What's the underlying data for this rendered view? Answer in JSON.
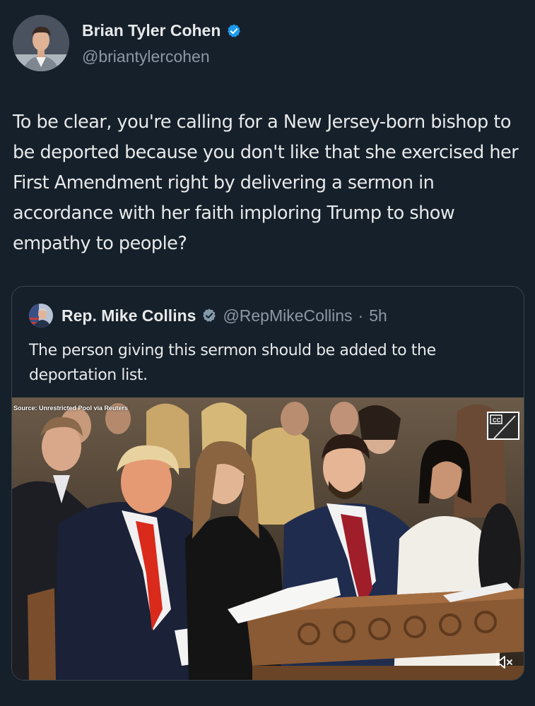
{
  "author": {
    "name": "Brian Tyler Cohen",
    "handle": "@briantylercohen"
  },
  "tweet": {
    "text": "To be clear, you're calling for a New Jersey-born bishop to be deported because you don't like that she exercised her First Amendment right by delivering a sermon in accordance with her faith imploring Trump to show empathy to people?"
  },
  "quote": {
    "name": "Rep. Mike Collins",
    "handle": "@RepMikeCollins",
    "separator": "·",
    "time": "5h",
    "text": "The person giving this sermon should be added to the deportation list."
  },
  "media": {
    "source": "Source: Unrestricted Pool via Reuters",
    "cc_label": "CC"
  },
  "colors": {
    "background": "#16202a",
    "verified_blue": "#1d9bf0",
    "verified_gray": "#829aab",
    "secondary_text": "#8b98a5"
  }
}
